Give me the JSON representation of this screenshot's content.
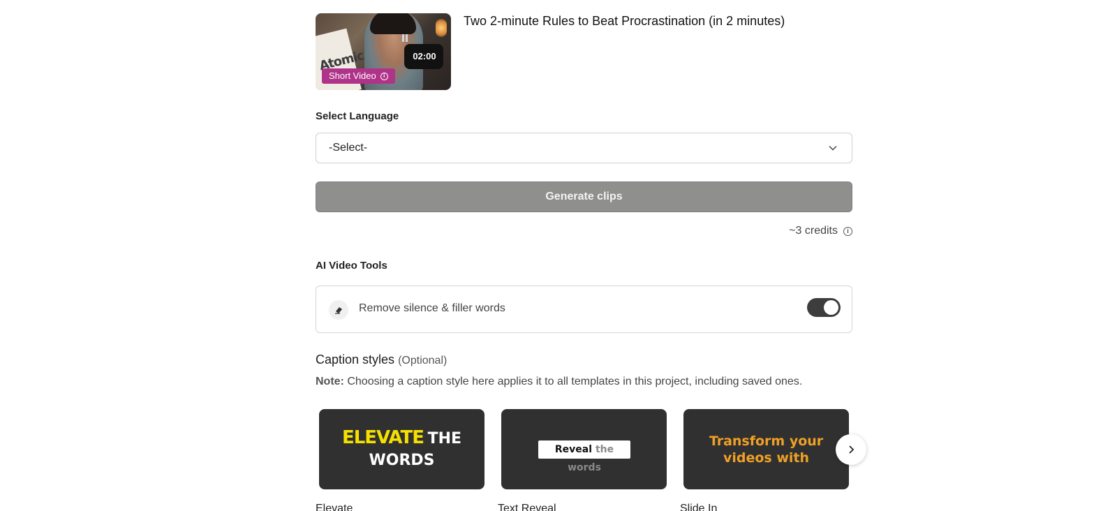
{
  "video": {
    "title": "Two 2-minute Rules to Beat Procrastination (in 2 minutes)",
    "duration": "02:00",
    "badge": "Short Video",
    "thumbnail_book_text": "Atomic Habits"
  },
  "language": {
    "label": "Select Language",
    "selected": "-Select-"
  },
  "generate": {
    "label": "Generate clips"
  },
  "credits": {
    "text": "~3 credits"
  },
  "tools": {
    "heading": "AI Video Tools",
    "items": [
      {
        "label": "Remove silence & filler words",
        "enabled": true
      }
    ]
  },
  "captions": {
    "heading": "Caption styles",
    "optional": "(Optional)",
    "note_label": "Note:",
    "note_text": "Choosing a caption style here applies it to all templates in this project, including saved ones.",
    "styles": [
      {
        "name": "Elevate",
        "preview_line1_highlight": "ELEVATE",
        "preview_line1_rest": "THE",
        "preview_line2": "WORDS"
      },
      {
        "name": "Text Reveal",
        "preview_bold": "Reveal",
        "preview_dim": "the words"
      },
      {
        "name": "Slide In",
        "preview_line1": "Transform your",
        "preview_line2": "videos with"
      }
    ]
  },
  "colors": {
    "badge": "#b0338a",
    "generate_disabled": "#8f8f8e",
    "toggle_on": "#3d3d3d",
    "card_bg": "#303030",
    "elevate_yellow": "#f6e000",
    "slide_orange": "#f0a026"
  }
}
